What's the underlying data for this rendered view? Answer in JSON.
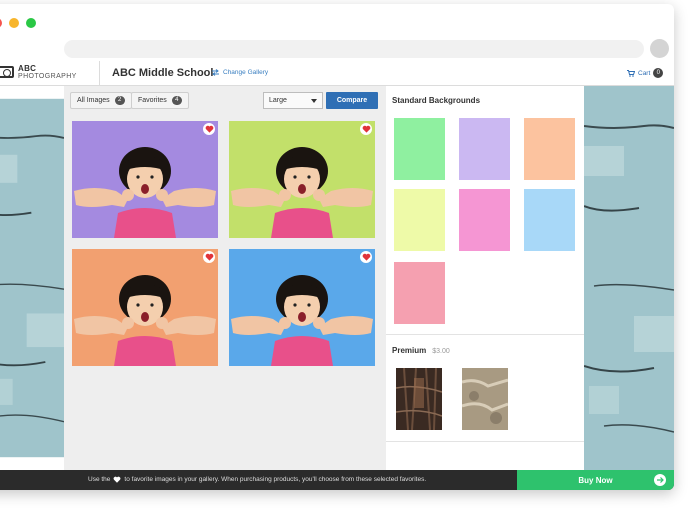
{
  "window": {
    "traffic_lights": {
      "close": "#f5544d",
      "minimize": "#f7b52c",
      "maximize": "#2ac845"
    }
  },
  "header": {
    "logo_top": "ABC",
    "logo_bottom": "PHOTOGRAPHY",
    "school_name": "ABC Middle School",
    "change_gallery": "Change Gallery",
    "cart_label": "Cart",
    "cart_count": "0"
  },
  "toolbar": {
    "all_images_label": "All Images",
    "all_images_count": "2",
    "favorites_label": "Favorites",
    "favorites_count": "4",
    "size_value": "Large",
    "compare_label": "Compare"
  },
  "gallery": {
    "photos": [
      {
        "background": "#a48ae0",
        "icon": "heart-icon"
      },
      {
        "background": "#c2e06a",
        "icon": "heart-icon"
      },
      {
        "background": "#f2a070",
        "icon": "heart-icon"
      },
      {
        "background": "#5aa8ea",
        "icon": "heart-icon"
      }
    ]
  },
  "backgrounds": {
    "title": "Standard Backgrounds",
    "swatches": [
      "#8ff0a0",
      "#cbb8f2",
      "#fcc39f",
      "#eefaa8",
      "#f596d3",
      "#a8d8f8",
      "#f5a0b0"
    ],
    "premium_title": "Premium",
    "premium_price": "$3.00"
  },
  "footer": {
    "tip_before": "Use the",
    "tip_after": "to favorite images in your gallery. When purchasing products, you'll choose from these selected favorites.",
    "buy_now": "Buy Now"
  },
  "colors": {
    "accent": "#2f6fb5",
    "buy": "#2ec26d",
    "heart": "#e0333a"
  }
}
